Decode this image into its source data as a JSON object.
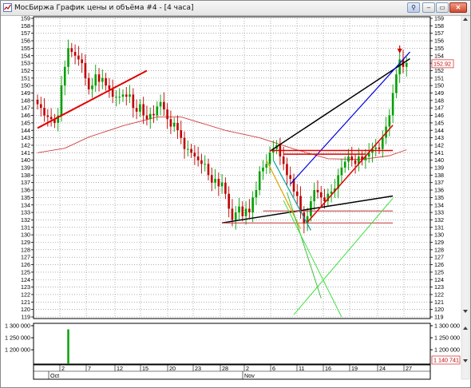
{
  "window": {
    "title": "МосБиржа График цены и объёма #4 - [4 часа]",
    "buttons": {
      "pin": "⚲",
      "minimize": "–",
      "maximize": "▭",
      "close": "✕"
    }
  },
  "price_axis": {
    "min": 119,
    "max": 159,
    "step": 1,
    "current_price": "152.92"
  },
  "volume_axis": {
    "labels": [
      "1 300 000",
      "1 250 000",
      "1 200 000"
    ],
    "values": [
      1300000,
      1250000,
      1200000
    ],
    "current_volume": "1 140 741"
  },
  "time_axis": {
    "day_labels": [
      "2",
      "7",
      "12",
      "15",
      "20",
      "23",
      "28",
      "2",
      "6",
      "11",
      "16",
      "19",
      "24",
      "27"
    ],
    "month_labels": [
      "Oct",
      "Nov"
    ]
  },
  "colors": {
    "up_candle": "#00a000",
    "down_candle": "#c00000",
    "moving_average": "#d04040",
    "grid": "#808080"
  },
  "chart_data": {
    "type": "candlestick",
    "timeframe": "4 часа",
    "ylim": [
      119,
      159
    ],
    "volume_ylim": [
      1140741,
      1310000
    ],
    "closes": [
      147.5,
      147,
      146,
      145.8,
      145.5,
      145,
      146,
      150,
      152.5,
      155,
      154.5,
      154,
      153.5,
      153,
      151,
      149.5,
      150,
      151.5,
      150.5,
      151,
      150,
      149.5,
      148.5,
      148.5,
      148.5,
      148.8,
      148.5,
      148.8,
      147,
      146.5,
      147.5,
      146,
      145.5,
      146.2,
      146,
      147.2,
      147.8,
      146.8,
      145.5,
      144.5,
      145,
      144,
      143,
      141.5,
      141.5,
      141,
      140.5,
      140,
      139.5,
      139.5,
      138,
      137,
      137.5,
      136.5,
      137,
      135.5,
      133.5,
      132,
      133,
      133.8,
      132.5,
      133.5,
      133,
      135,
      136,
      138.5,
      139,
      139.5,
      141,
      141.5,
      142,
      140.5,
      139.5,
      138,
      137.5,
      135.8,
      135.2,
      133,
      131.5,
      132.5,
      134.5,
      136,
      135.7,
      135,
      134.5,
      135.5,
      135.8,
      136.2,
      138,
      139,
      139.8,
      140.5,
      140,
      139.5,
      140.5,
      140,
      140.5,
      141,
      141.5,
      141.7,
      141.5,
      143,
      144.5,
      146,
      149,
      151.5,
      153.5,
      152.5,
      153
    ],
    "moving_average": [
      {
        "x": 0,
        "y": 141
      },
      {
        "x": 8,
        "y": 141.6
      },
      {
        "x": 15,
        "y": 143.1
      },
      {
        "x": 25,
        "y": 144.6
      },
      {
        "x": 35,
        "y": 145.8
      },
      {
        "x": 42,
        "y": 145.8
      },
      {
        "x": 55,
        "y": 144
      },
      {
        "x": 65,
        "y": 143
      },
      {
        "x": 75,
        "y": 141.5
      },
      {
        "x": 85,
        "y": 140.2
      },
      {
        "x": 95,
        "y": 140.1
      },
      {
        "x": 103,
        "y": 140.6
      },
      {
        "x": 108,
        "y": 141.4
      }
    ],
    "volume_spike": {
      "x": 9,
      "value": 1285000
    },
    "trendlines": [
      {
        "color": "#e00000",
        "width": 2,
        "from": {
          "x": 0,
          "y": 144.3
        },
        "to": {
          "x": 32,
          "y": 152
        }
      },
      {
        "color": "#000000",
        "width": 1.5,
        "from": {
          "x": 68,
          "y": 141.2
        },
        "to": {
          "x": 109,
          "y": 153.6
        }
      },
      {
        "color": "#0000e0",
        "width": 1.2,
        "from": {
          "x": 74,
          "y": 136.8
        },
        "to": {
          "x": 109,
          "y": 154.5
        }
      },
      {
        "color": "#e00000",
        "width": 1.5,
        "from": {
          "x": 68,
          "y": 141.3
        },
        "to": {
          "x": 104,
          "y": 141.3
        }
      },
      {
        "color": "#e00000",
        "width": 1.5,
        "from": {
          "x": 72,
          "y": 140.8
        },
        "to": {
          "x": 96,
          "y": 140.8
        }
      },
      {
        "color": "#000000",
        "width": 1.5,
        "from": {
          "x": 54,
          "y": 131.6
        },
        "to": {
          "x": 104,
          "y": 135.2
        }
      },
      {
        "color": "#c03030",
        "width": 1,
        "from": {
          "x": 54,
          "y": 131.6
        },
        "to": {
          "x": 104,
          "y": 131.6
        }
      },
      {
        "color": "#c03030",
        "width": 1,
        "from": {
          "x": 66,
          "y": 133.2
        },
        "to": {
          "x": 104,
          "y": 133.2
        }
      },
      {
        "color": "#e00000",
        "width": 1.5,
        "from": {
          "x": 79,
          "y": 131.7
        },
        "to": {
          "x": 104,
          "y": 144.7
        }
      },
      {
        "color": "#e0a000",
        "width": 1.2,
        "from": {
          "x": 67,
          "y": 140
        },
        "to": {
          "x": 77,
          "y": 130.8
        }
      },
      {
        "color": "#00a0a0",
        "width": 1.2,
        "from": {
          "x": 69,
          "y": 140
        },
        "to": {
          "x": 80,
          "y": 130.6
        }
      },
      {
        "color": "#40c040",
        "width": 1,
        "from": {
          "x": 73,
          "y": 135.7
        },
        "to": {
          "x": 83,
          "y": 121.5
        }
      },
      {
        "color": "#40e040",
        "width": 1,
        "from": {
          "x": 72,
          "y": 134.6
        },
        "to": {
          "x": 89,
          "y": 119
        }
      },
      {
        "color": "#40e040",
        "width": 1,
        "from": {
          "x": 75,
          "y": 119.3
        },
        "to": {
          "x": 104,
          "y": 134.9
        }
      }
    ],
    "marker": {
      "x": 106,
      "y": 154.3,
      "color": "#d00000"
    }
  }
}
